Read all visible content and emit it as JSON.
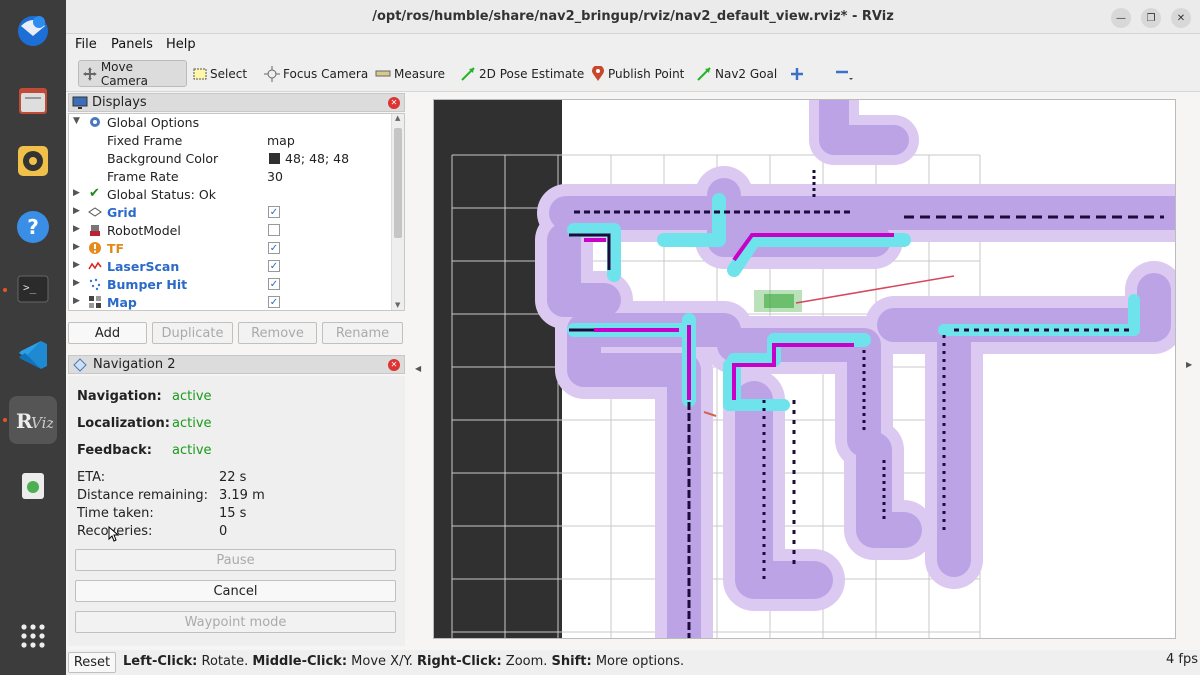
{
  "window": {
    "title": "/opt/ros/humble/share/nav2_bringup/rviz/nav2_default_view.rviz* - RViz"
  },
  "menu": [
    "File",
    "Panels",
    "Help"
  ],
  "toolbar": {
    "tools": [
      "Move Camera",
      "Select",
      "Focus Camera",
      "Measure",
      "2D Pose Estimate",
      "Publish Point",
      "Nav2 Goal"
    ]
  },
  "displays": {
    "title": "Displays",
    "global_options": "Global Options",
    "fixed_frame_label": "Fixed Frame",
    "fixed_frame_value": "map",
    "bg_color_label": "Background Color",
    "bg_color_value": "48; 48; 48",
    "frame_rate_label": "Frame Rate",
    "frame_rate_value": "30",
    "global_status": "Global Status: Ok",
    "items": [
      {
        "label": "Grid",
        "checked": true
      },
      {
        "label": "RobotModel",
        "checked": false
      },
      {
        "label": "TF",
        "checked": true
      },
      {
        "label": "LaserScan",
        "checked": true
      },
      {
        "label": "Bumper Hit",
        "checked": true
      },
      {
        "label": "Map",
        "checked": true
      }
    ],
    "buttons": [
      "Add",
      "Duplicate",
      "Remove",
      "Rename"
    ]
  },
  "navigation_panel": {
    "title": "Navigation 2",
    "navigation_label": "Navigation:",
    "navigation_value": "active",
    "localization_label": "Localization:",
    "localization_value": "active",
    "feedback_label": "Feedback:",
    "feedback_value": "active",
    "eta_label": "ETA:",
    "eta_value": "22 s",
    "distance_label": "Distance remaining:",
    "distance_value": "3.19 m",
    "time_label": "Time taken:",
    "time_value": "15 s",
    "recoveries_label": "Recoveries:",
    "recoveries_value": "0",
    "pause": "Pause",
    "cancel": "Cancel",
    "waypoint": "Waypoint mode"
  },
  "status": {
    "reset": "Reset",
    "left_click": "Left-Click:",
    "left_click_desc": " Rotate. ",
    "middle_click": "Middle-Click:",
    "middle_click_desc": " Move X/Y. ",
    "right_click": "Right-Click:",
    "right_click_desc": " Zoom. ",
    "shift": "Shift:",
    "shift_desc": " More options.",
    "fps": "4 fps"
  },
  "colors": {
    "dock": "#3c3c3c",
    "costmap_outer": "#d7c3ef",
    "costmap_inner": "#b59ae3",
    "inflation": "#6de3ec",
    "path": "#cc00cc",
    "obstacle": "#1a0a3a",
    "status_active": "#1a9a1a"
  }
}
